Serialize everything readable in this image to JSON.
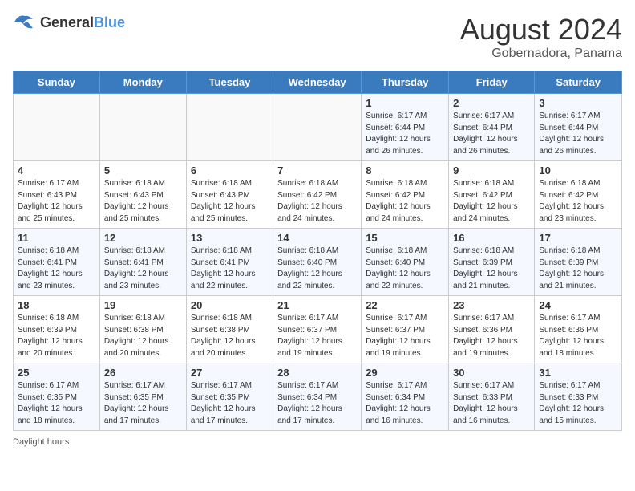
{
  "header": {
    "logo_general": "General",
    "logo_blue": "Blue",
    "month_year": "August 2024",
    "location": "Gobernadora, Panama"
  },
  "days_of_week": [
    "Sunday",
    "Monday",
    "Tuesday",
    "Wednesday",
    "Thursday",
    "Friday",
    "Saturday"
  ],
  "weeks": [
    [
      {
        "day": "",
        "info": ""
      },
      {
        "day": "",
        "info": ""
      },
      {
        "day": "",
        "info": ""
      },
      {
        "day": "",
        "info": ""
      },
      {
        "day": "1",
        "info": "Sunrise: 6:17 AM\nSunset: 6:44 PM\nDaylight: 12 hours\nand 26 minutes."
      },
      {
        "day": "2",
        "info": "Sunrise: 6:17 AM\nSunset: 6:44 PM\nDaylight: 12 hours\nand 26 minutes."
      },
      {
        "day": "3",
        "info": "Sunrise: 6:17 AM\nSunset: 6:44 PM\nDaylight: 12 hours\nand 26 minutes."
      }
    ],
    [
      {
        "day": "4",
        "info": "Sunrise: 6:17 AM\nSunset: 6:43 PM\nDaylight: 12 hours\nand 25 minutes."
      },
      {
        "day": "5",
        "info": "Sunrise: 6:18 AM\nSunset: 6:43 PM\nDaylight: 12 hours\nand 25 minutes."
      },
      {
        "day": "6",
        "info": "Sunrise: 6:18 AM\nSunset: 6:43 PM\nDaylight: 12 hours\nand 25 minutes."
      },
      {
        "day": "7",
        "info": "Sunrise: 6:18 AM\nSunset: 6:42 PM\nDaylight: 12 hours\nand 24 minutes."
      },
      {
        "day": "8",
        "info": "Sunrise: 6:18 AM\nSunset: 6:42 PM\nDaylight: 12 hours\nand 24 minutes."
      },
      {
        "day": "9",
        "info": "Sunrise: 6:18 AM\nSunset: 6:42 PM\nDaylight: 12 hours\nand 24 minutes."
      },
      {
        "day": "10",
        "info": "Sunrise: 6:18 AM\nSunset: 6:42 PM\nDaylight: 12 hours\nand 23 minutes."
      }
    ],
    [
      {
        "day": "11",
        "info": "Sunrise: 6:18 AM\nSunset: 6:41 PM\nDaylight: 12 hours\nand 23 minutes."
      },
      {
        "day": "12",
        "info": "Sunrise: 6:18 AM\nSunset: 6:41 PM\nDaylight: 12 hours\nand 23 minutes."
      },
      {
        "day": "13",
        "info": "Sunrise: 6:18 AM\nSunset: 6:41 PM\nDaylight: 12 hours\nand 22 minutes."
      },
      {
        "day": "14",
        "info": "Sunrise: 6:18 AM\nSunset: 6:40 PM\nDaylight: 12 hours\nand 22 minutes."
      },
      {
        "day": "15",
        "info": "Sunrise: 6:18 AM\nSunset: 6:40 PM\nDaylight: 12 hours\nand 22 minutes."
      },
      {
        "day": "16",
        "info": "Sunrise: 6:18 AM\nSunset: 6:39 PM\nDaylight: 12 hours\nand 21 minutes."
      },
      {
        "day": "17",
        "info": "Sunrise: 6:18 AM\nSunset: 6:39 PM\nDaylight: 12 hours\nand 21 minutes."
      }
    ],
    [
      {
        "day": "18",
        "info": "Sunrise: 6:18 AM\nSunset: 6:39 PM\nDaylight: 12 hours\nand 20 minutes."
      },
      {
        "day": "19",
        "info": "Sunrise: 6:18 AM\nSunset: 6:38 PM\nDaylight: 12 hours\nand 20 minutes."
      },
      {
        "day": "20",
        "info": "Sunrise: 6:18 AM\nSunset: 6:38 PM\nDaylight: 12 hours\nand 20 minutes."
      },
      {
        "day": "21",
        "info": "Sunrise: 6:17 AM\nSunset: 6:37 PM\nDaylight: 12 hours\nand 19 minutes."
      },
      {
        "day": "22",
        "info": "Sunrise: 6:17 AM\nSunset: 6:37 PM\nDaylight: 12 hours\nand 19 minutes."
      },
      {
        "day": "23",
        "info": "Sunrise: 6:17 AM\nSunset: 6:36 PM\nDaylight: 12 hours\nand 19 minutes."
      },
      {
        "day": "24",
        "info": "Sunrise: 6:17 AM\nSunset: 6:36 PM\nDaylight: 12 hours\nand 18 minutes."
      }
    ],
    [
      {
        "day": "25",
        "info": "Sunrise: 6:17 AM\nSunset: 6:35 PM\nDaylight: 12 hours\nand 18 minutes."
      },
      {
        "day": "26",
        "info": "Sunrise: 6:17 AM\nSunset: 6:35 PM\nDaylight: 12 hours\nand 17 minutes."
      },
      {
        "day": "27",
        "info": "Sunrise: 6:17 AM\nSunset: 6:35 PM\nDaylight: 12 hours\nand 17 minutes."
      },
      {
        "day": "28",
        "info": "Sunrise: 6:17 AM\nSunset: 6:34 PM\nDaylight: 12 hours\nand 17 minutes."
      },
      {
        "day": "29",
        "info": "Sunrise: 6:17 AM\nSunset: 6:34 PM\nDaylight: 12 hours\nand 16 minutes."
      },
      {
        "day": "30",
        "info": "Sunrise: 6:17 AM\nSunset: 6:33 PM\nDaylight: 12 hours\nand 16 minutes."
      },
      {
        "day": "31",
        "info": "Sunrise: 6:17 AM\nSunset: 6:33 PM\nDaylight: 12 hours\nand 15 minutes."
      }
    ]
  ],
  "footer": {
    "note": "Daylight hours"
  }
}
